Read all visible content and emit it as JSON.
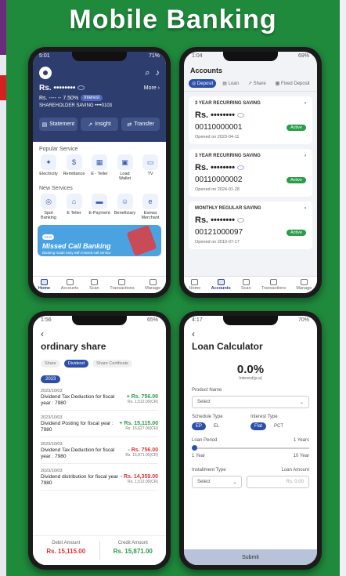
{
  "headline": "Mobile Banking",
  "colors": {
    "background": "#1f8a3c",
    "primary": "#2d3d6e",
    "accent": "#2d4fa8",
    "positive": "#2a9d4b",
    "negative": "#d63838"
  },
  "phone1": {
    "status_time": "5:01",
    "status_right": "71%",
    "account": {
      "masked_balance": "Rs. ••••••••",
      "more": "More",
      "rate": "Rs. ---- -- 7.50%",
      "interest_tag": "Interest",
      "type": "SHAREHOLDER SAVING ••••0103"
    },
    "buttons": [
      "Statement",
      "Insight",
      "Transfer"
    ],
    "popular_title": "Popular Service",
    "popular": [
      "Electricity",
      "Remittance",
      "E - Teller",
      "Load Wallet",
      "TV"
    ],
    "new_title": "New Services",
    "new": [
      "Spot Banking",
      "E Teller",
      "E-Payment",
      "Beneficiary",
      "Esewa Merchant"
    ],
    "banner": {
      "tag": "NEW",
      "title": "Missed Call Banking",
      "sub": "Banking made easy with missed call service"
    },
    "nav": [
      "Home",
      "Accounts",
      "Scan",
      "Transactions",
      "Manage"
    ]
  },
  "phone2": {
    "status_time": "1:04",
    "status_right": "69%",
    "title": "Accounts",
    "tabs": [
      "Deposit",
      "Loan",
      "Share",
      "Fixed Deposit"
    ],
    "cards": [
      {
        "name": "3 YEAR RECURRING SAVING",
        "balance": "Rs. ••••••••",
        "number": "00110000001",
        "status": "Active",
        "opened": "Opened on 2023-04-11"
      },
      {
        "name": "3 YEAR RECURRING SAVING",
        "balance": "Rs. ••••••••",
        "number": "00110000002",
        "status": "Active",
        "opened": "Opened on 2024-01-28"
      },
      {
        "name": "MONTHLY REGULAR SAVING",
        "balance": "Rs. ••••••••",
        "number": "00121000097",
        "status": "Active",
        "opened": "Opened on 2010-07-17"
      }
    ],
    "nav": [
      "Home",
      "Accounts",
      "Scan",
      "Transactions",
      "Manage"
    ]
  },
  "phone3": {
    "status_time": "1:56",
    "status_right": "65%",
    "title": "ordinary share",
    "chips": [
      "Share",
      "Dividend",
      "Share Certificate"
    ],
    "year": "2023",
    "txns": [
      {
        "date": "2023/10/03",
        "desc": "Dividend Tax Deduction for fiscal year : 7980",
        "amount": "+ Rs. 756.00",
        "bal": "Rs. 1,512.00(CR)"
      },
      {
        "date": "2023/10/03",
        "desc": "Dividend Posting for fiscal year : 7980",
        "amount": "+ Rs. 15,115.00",
        "bal": "Rs. 16,627.00(CR)"
      },
      {
        "date": "2023/10/03",
        "desc": "Dividend Tax Deduction for fiscal year : 7980",
        "amount": "- Rs. 756.00",
        "bal": "Rs. 15,871.00(CR)"
      },
      {
        "date": "2023/10/03",
        "desc": "Dividend distribution for fiscal year 7980",
        "amount": "- Rs. 14,359.00",
        "bal": "Rs. 1,512.00(CR)"
      }
    ],
    "summary": {
      "debit_label": "Debit Amount",
      "debit": "Rs. 15,115.00",
      "credit_label": "Credit Amount",
      "credit": "Rs. 15,871.00"
    }
  },
  "phone4": {
    "status_time": "4:17",
    "status_right": "70%",
    "title": "Loan Calculator",
    "rate": "0.0%",
    "rate_sub": "Interest(p.a)",
    "product_label": "Product Name",
    "product_placeholder": "Select",
    "schedule_label": "Schedule Type",
    "schedule": [
      "EP",
      "EL"
    ],
    "interest_label": "Interest Type",
    "interest": [
      "Flat",
      "PCT"
    ],
    "period_label": "Loan Period",
    "period_value": "1 Years",
    "period_min": "1 Year",
    "period_max": "10 Year",
    "installment_label": "Installment Type",
    "loan_amount_label": "Loan Amount",
    "installment_placeholder": "Select",
    "amount_placeholder": "Rs. 0.00",
    "submit": "Submit"
  }
}
